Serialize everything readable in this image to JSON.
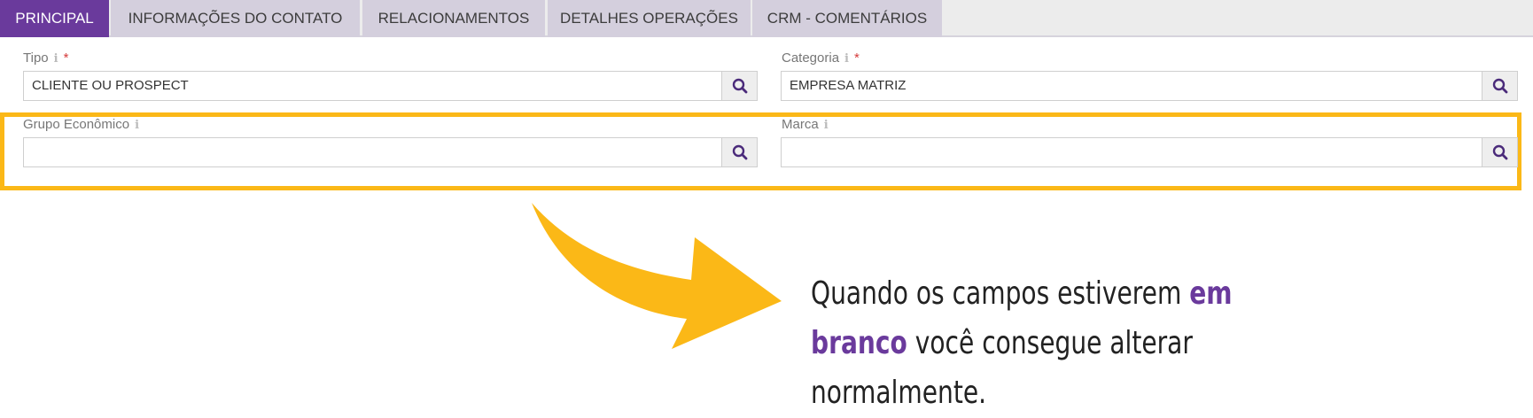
{
  "tabs": [
    {
      "label": "PRINCIPAL",
      "active": true
    },
    {
      "label": "INFORMAÇÕES DO CONTATO",
      "active": false
    },
    {
      "label": "RELACIONAMENTOS",
      "active": false
    },
    {
      "label": "DETALHES OPERAÇÕES",
      "active": false
    },
    {
      "label": "CRM - COMENTÁRIOS",
      "active": false
    }
  ],
  "fields": {
    "tipo": {
      "label": "Tipo",
      "required_mark": "*",
      "value": "CLIENTE OU PROSPECT"
    },
    "categoria": {
      "label": "Categoria",
      "required_mark": "*",
      "value": "EMPRESA MATRIZ"
    },
    "grupo_economico": {
      "label": "Grupo Econômico",
      "value": ""
    },
    "marca": {
      "label": "Marca",
      "value": ""
    }
  },
  "info_glyph": "i",
  "callout": {
    "text_before": "Quando os campos estiverem ",
    "text_highlight": "em branco",
    "text_after": " você consegue alterar normalmente."
  },
  "icons": {
    "lookup": "search-icon",
    "info": "info-icon",
    "arrow": "curved-arrow-icon"
  },
  "colors": {
    "accent": "#6a3a9c",
    "highlight": "#fbb817",
    "required": "#d53b3b"
  }
}
